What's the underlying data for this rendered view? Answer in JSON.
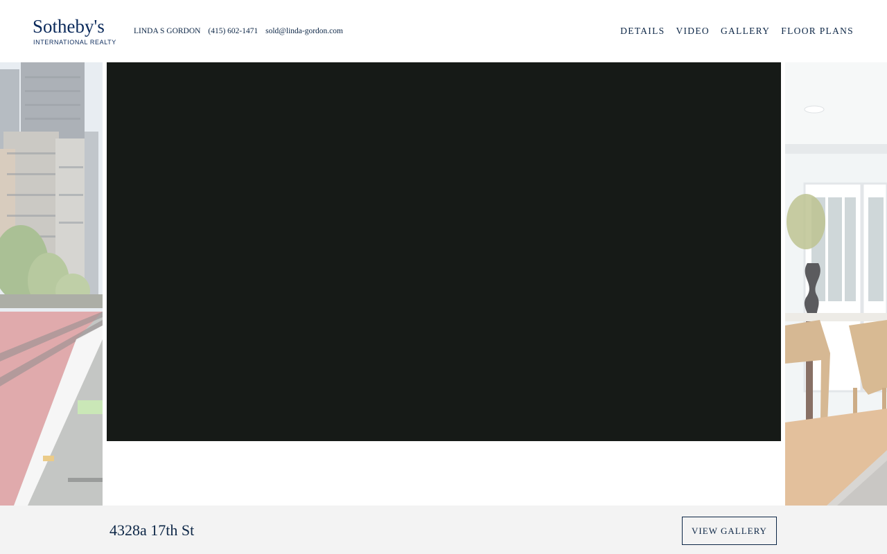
{
  "brand": {
    "name": "Sotheby's",
    "subtitle": "INTERNATIONAL REALTY",
    "color": "#0b2a5b"
  },
  "agent": {
    "name": "LINDA S GORDON",
    "phone": "(415) 602-1471",
    "email": "sold@linda-gordon.com"
  },
  "nav": {
    "items": [
      {
        "label": "DETAILS"
      },
      {
        "label": "VIDEO"
      },
      {
        "label": "GALLERY"
      },
      {
        "label": "FLOOR PLANS"
      }
    ]
  },
  "video": {
    "background": "#161a17"
  },
  "footer": {
    "address": "4328a 17th St",
    "view_gallery_label": "VIEW GALLERY"
  }
}
